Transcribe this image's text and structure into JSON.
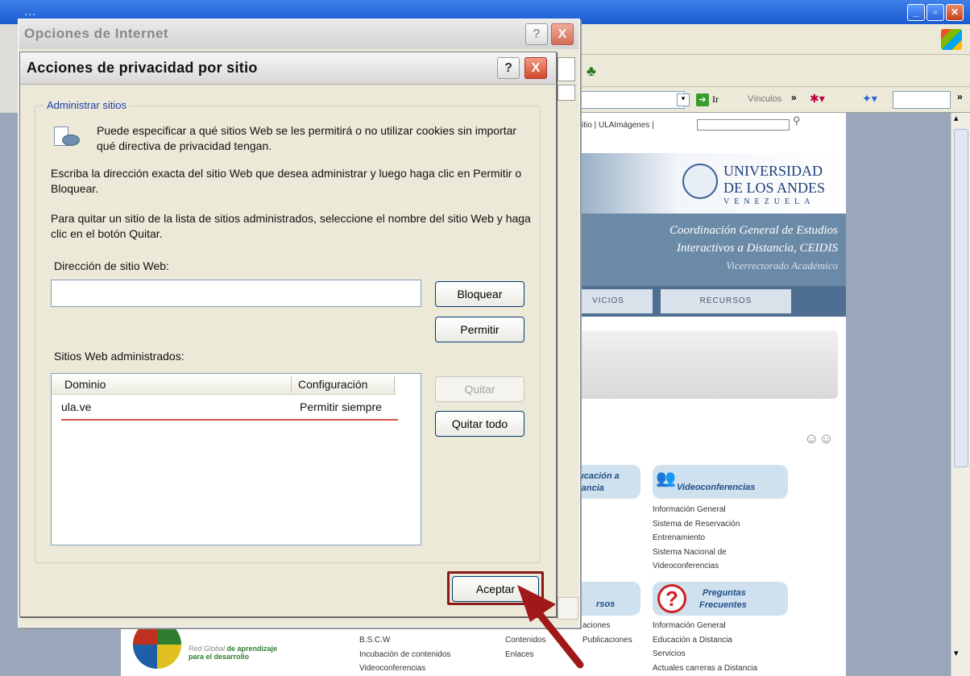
{
  "browser": {
    "title": "...",
    "address_go": "Ir",
    "links_label": "Vínculos",
    "site_toplinks": "l sitio | ULAImágenes |",
    "university_name_line1": "UNIVERSIDAD",
    "university_name_line2": "DE LOS ANDES",
    "university_name_line3": "VENEZUELA",
    "coordination_line1": "Coordinación General de Estudios",
    "coordination_line2": "Interactivos a Distancia, CEIDIS",
    "vicerrectorado": "Vicerrectorado Académico",
    "tab_services": "VICIOS",
    "tab_resources": "RECURSOS",
    "pill_education_line1": "ucación a",
    "pill_education_line2": "tancia",
    "pill_video": "Videoconferencias",
    "video_links": [
      "Información General",
      "Sistema de Reservación",
      "Entrenamiento",
      "Sistema Nacional de",
      "Videoconferencias"
    ],
    "pill_rsos": "rsos",
    "pill_faq_line1": "Preguntas",
    "pill_faq_line2": "Frecuentes",
    "faq_links": [
      "Información General",
      "Educación a Distancia",
      "Servicios",
      "Actuales carreras a Distancia"
    ],
    "bottom_col1": [
      "B.S.C.W",
      "Incubación de contenidos",
      "Videoconferencias"
    ],
    "bottom_col2": [
      "Contenidos",
      "Enlaces"
    ],
    "bottom_col3": [
      "aciones",
      "Publicaciones"
    ],
    "red_global_line1": "Red Global",
    "red_global_line1b": "de aprendizaje",
    "red_global_line2": "para el desarrollo"
  },
  "outer_dialog": {
    "title": "Opciones de Internet",
    "help": "?",
    "close": "X"
  },
  "privacy_dialog": {
    "title": "Acciones de privacidad por sitio",
    "help": "?",
    "close": "X",
    "group_label": "Administrar sitios",
    "intro": "Puede especificar a qué sitios Web se les permitirá o no utilizar cookies sin importar qué directiva de privacidad tengan.",
    "instructions1": "Escriba la dirección exacta del sitio Web que desea administrar y luego haga clic en Permitir o Bloquear.",
    "instructions2": "Para quitar un sitio de la lista de sitios administrados, seleccione el nombre del sitio Web y haga clic en el botón Quitar.",
    "address_label": "Dirección de sitio Web:",
    "address_value": "",
    "block_button": "Bloquear",
    "allow_button": "Permitir",
    "managed_label": "Sitios Web administrados:",
    "columns": [
      "Dominio",
      "Configuración"
    ],
    "rows": [
      {
        "domain": "ula.ve",
        "setting": "Permitir siempre"
      }
    ],
    "remove_button": "Quitar",
    "remove_all_button": "Quitar todo",
    "accept_button": "Aceptar"
  },
  "colors": {
    "accent_highlight": "#8a1a1a",
    "arrow": "#a01818",
    "underline": "#d9534f"
  }
}
